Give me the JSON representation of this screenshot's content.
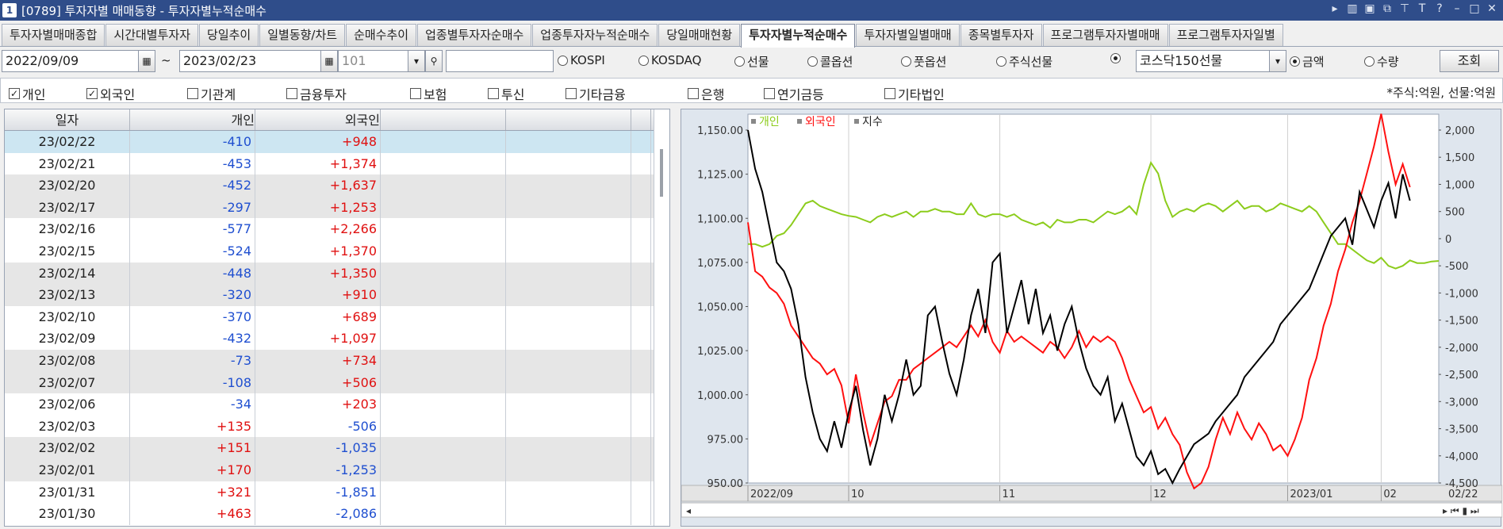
{
  "window": {
    "number": "1",
    "title": "[0789] 투자자별 매매동향 - 투자자별누적순매수",
    "controls": [
      "▸",
      "▥",
      "▣",
      "⧉",
      "⊤",
      "T",
      "?",
      "–",
      "□",
      "✕"
    ]
  },
  "tabs": [
    {
      "label": "투자자별매매종합",
      "active": false
    },
    {
      "label": "시간대별투자자",
      "active": false
    },
    {
      "label": "당일추이",
      "active": false
    },
    {
      "label": "일별동향/차트",
      "active": false
    },
    {
      "label": "순매수추이",
      "active": false
    },
    {
      "label": "업종별투자자순매수",
      "active": false
    },
    {
      "label": "업종투자자누적순매수",
      "active": false
    },
    {
      "label": "당일매매현황",
      "active": false
    },
    {
      "label": "투자자별누적순매수",
      "active": true
    },
    {
      "label": "투자자별일별매매",
      "active": false
    },
    {
      "label": "종목별투자자",
      "active": false
    },
    {
      "label": "프로그램투자자별매매",
      "active": false
    },
    {
      "label": "프로그램투자자일별",
      "active": false
    }
  ],
  "query": {
    "start_date": "2022/09/09",
    "tilde": "~",
    "end_date": "2023/02/23",
    "code": "101",
    "markets": [
      {
        "label": "KOSPI",
        "checked": false
      },
      {
        "label": "KOSDAQ",
        "checked": false
      },
      {
        "label": "선물",
        "checked": false
      },
      {
        "label": "콜옵션",
        "checked": false
      },
      {
        "label": "풋옵션",
        "checked": false
      },
      {
        "label": "주식선물",
        "checked": false
      },
      {
        "label": "",
        "checked": true
      }
    ],
    "product": "코스닥150선물",
    "amount_label": "금액",
    "quantity_label": "수량",
    "search_label": "조회"
  },
  "investors": [
    {
      "label": "개인",
      "checked": true
    },
    {
      "label": "외국인",
      "checked": true
    },
    {
      "label": "기관계",
      "checked": false
    },
    {
      "label": "금융투자",
      "checked": false
    },
    {
      "label": "보험",
      "checked": false
    },
    {
      "label": "투신",
      "checked": false
    },
    {
      "label": "기타금융",
      "checked": false
    },
    {
      "label": "은행",
      "checked": false
    },
    {
      "label": "연기금등",
      "checked": false
    },
    {
      "label": "기타법인",
      "checked": false
    }
  ],
  "unit_note": "*주식:억원, 선물:억원",
  "table": {
    "headers": [
      "일자",
      "개인",
      "외국인",
      "",
      "",
      ""
    ],
    "rows": [
      [
        "23/02/22",
        "-410",
        "+948"
      ],
      [
        "23/02/21",
        "-453",
        "+1,374"
      ],
      [
        "23/02/20",
        "-452",
        "+1,637"
      ],
      [
        "23/02/17",
        "-297",
        "+1,253"
      ],
      [
        "23/02/16",
        "-577",
        "+2,266"
      ],
      [
        "23/02/15",
        "-524",
        "+1,370"
      ],
      [
        "23/02/14",
        "-448",
        "+1,350"
      ],
      [
        "23/02/13",
        "-320",
        "+910"
      ],
      [
        "23/02/10",
        "-370",
        "+689"
      ],
      [
        "23/02/09",
        "-432",
        "+1,097"
      ],
      [
        "23/02/08",
        "-73",
        "+734"
      ],
      [
        "23/02/07",
        "-108",
        "+506"
      ],
      [
        "23/02/06",
        "-34",
        "+203"
      ],
      [
        "23/02/03",
        "+135",
        "-506"
      ],
      [
        "23/02/02",
        "+151",
        "-1,035"
      ],
      [
        "23/02/01",
        "+170",
        "-1,253"
      ],
      [
        "23/01/31",
        "+321",
        "-1,851"
      ],
      [
        "23/01/30",
        "+463",
        "-2,086"
      ]
    ]
  },
  "chart_data": {
    "type": "line",
    "legend": [
      {
        "name": "개인",
        "color": "#8ccc1c"
      },
      {
        "name": "외국인",
        "color": "#ff1010"
      },
      {
        "name": "지수",
        "color": "#000000"
      }
    ],
    "left_ticks": [
      "1,150.00",
      "1,125.00",
      "1,100.00",
      "1,075.00",
      "1,050.00",
      "1,025.00",
      "1,000.00",
      "975.00",
      "950.00"
    ],
    "right_ticks": [
      "2,000",
      "1,500",
      "1,000",
      "500",
      "0",
      "-500",
      "-1,000",
      "-1,500",
      "-2,000",
      "-2,500",
      "-3,000",
      "-3,500",
      "-4,000",
      "-4,500"
    ],
    "x_ticks": [
      "2022/09",
      "10",
      "11",
      "12",
      "2023/01",
      "02"
    ],
    "x_end_label": "02/22",
    "ylim_left": [
      950,
      1150
    ],
    "ylim_right": [
      -4500,
      2000
    ],
    "series": [
      {
        "name": "개인",
        "axis": "right",
        "values": [
          -100,
          -100,
          -150,
          -100,
          50,
          100,
          250,
          450,
          650,
          700,
          600,
          550,
          500,
          450,
          420,
          400,
          350,
          300,
          400,
          450,
          400,
          450,
          500,
          400,
          500,
          500,
          550,
          500,
          500,
          450,
          450,
          650,
          450,
          400,
          450,
          450,
          400,
          450,
          350,
          300,
          250,
          300,
          200,
          350,
          300,
          300,
          350,
          350,
          300,
          400,
          500,
          450,
          500,
          600,
          450,
          1000,
          1400,
          1200,
          700,
          400,
          500,
          550,
          500,
          600,
          650,
          600,
          500,
          600,
          700,
          550,
          600,
          600,
          500,
          550,
          650,
          600,
          550,
          500,
          600,
          500,
          300,
          100,
          -100,
          -100,
          -200,
          -300,
          -400,
          -450,
          -350,
          -500,
          -550,
          -500,
          -400,
          -450,
          -450,
          -420,
          -410
        ]
      },
      {
        "name": "외국인",
        "axis": "right",
        "values": [
          300,
          -600,
          -700,
          -900,
          -1000,
          -1200,
          -1600,
          -1800,
          -2000,
          -2200,
          -2300,
          -2500,
          -2400,
          -2700,
          -3400,
          -2500,
          -3200,
          -3800,
          -3400,
          -3000,
          -2900,
          -2600,
          -2600,
          -2400,
          -2300,
          -2200,
          -2100,
          -2000,
          -1900,
          -2000,
          -1800,
          -1600,
          -1800,
          -1500,
          -1900,
          -2100,
          -1700,
          -1900,
          -1800,
          -1900,
          -2000,
          -2100,
          -1900,
          -2000,
          -2200,
          -2000,
          -1700,
          -2000,
          -1800,
          -1900,
          -1800,
          -1900,
          -2200,
          -2600,
          -2900,
          -3200,
          -3100,
          -3500,
          -3300,
          -3600,
          -3800,
          -4300,
          -4600,
          -4500,
          -4200,
          -3700,
          -3300,
          -3600,
          -3200,
          -3500,
          -3700,
          -3400,
          -3600,
          -3900,
          -3800,
          -4000,
          -3700,
          -3300,
          -2600,
          -2200,
          -1600,
          -1200,
          -600,
          -200,
          300,
          700,
          1200,
          1700,
          2300,
          1600,
          1000,
          1374,
          948
        ]
      },
      {
        "name": "지수",
        "axis": "left",
        "values": [
          1150,
          1128,
          1115,
          1095,
          1075,
          1070,
          1060,
          1040,
          1010,
          990,
          975,
          968,
          985,
          970,
          990,
          1005,
          980,
          960,
          975,
          1000,
          985,
          1000,
          1020,
          1000,
          1005,
          1045,
          1050,
          1030,
          1012,
          1000,
          1020,
          1045,
          1060,
          1035,
          1075,
          1080,
          1035,
          1050,
          1065,
          1040,
          1060,
          1035,
          1045,
          1025,
          1040,
          1050,
          1030,
          1015,
          1005,
          1000,
          1010,
          985,
          995,
          980,
          965,
          960,
          968,
          955,
          958,
          950,
          958,
          965,
          972,
          975,
          978,
          985,
          990,
          995,
          1000,
          1010,
          1015,
          1020,
          1025,
          1030,
          1040,
          1045,
          1050,
          1055,
          1060,
          1070,
          1080,
          1090,
          1095,
          1100,
          1085,
          1115,
          1105,
          1095,
          1110,
          1120,
          1100,
          1125,
          1110
        ]
      }
    ]
  }
}
